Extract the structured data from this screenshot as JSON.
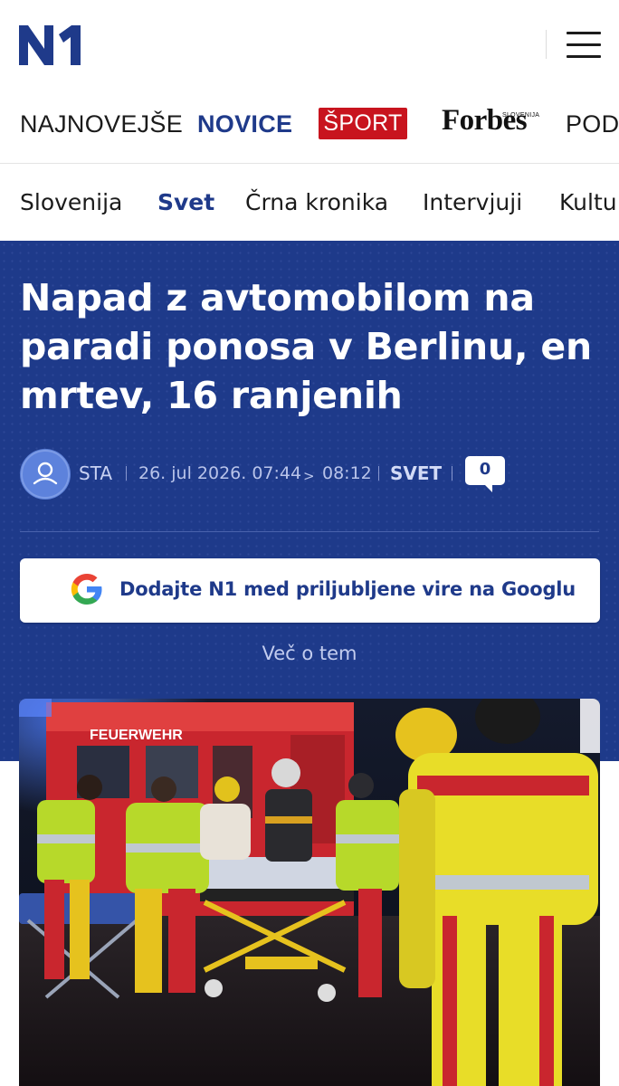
{
  "header": {
    "logo_text": "N1",
    "menu_icon": "hamburger-menu-icon"
  },
  "primary_nav": {
    "items": [
      {
        "label": "NAJNOVEJŠE"
      },
      {
        "label": "NOVICE"
      },
      {
        "label": "ŠPORT"
      },
      {
        "label": "Forbes",
        "sup": "SLOVENIJA"
      },
      {
        "label": "PODK"
      }
    ],
    "active": "NOVICE",
    "sport_color": "#c8141e",
    "accent_color": "#1f3a8a"
  },
  "secondary_nav": {
    "items": [
      {
        "label": "Slovenija"
      },
      {
        "label": "Svet"
      },
      {
        "label": "Črna kronika"
      },
      {
        "label": "Intervjuji"
      },
      {
        "label": "Kultu"
      }
    ],
    "active": "Svet"
  },
  "article": {
    "headline": "Napad z avtomobilom na paradi ponosa v Berlinu, en mrtev, 16 ranjenih",
    "author": "STA",
    "published": "26. jul 2026. 07:44",
    "arrow": ">",
    "updated": "08:12",
    "category": "SVET",
    "comment_count": "0",
    "google_cta": "Dodajte N1 med priljubljene vire na Googlu",
    "more_link": "Več o tem",
    "hero_bg_color": "#1e3a8a",
    "image_icon": "emergency-scene-photo"
  }
}
